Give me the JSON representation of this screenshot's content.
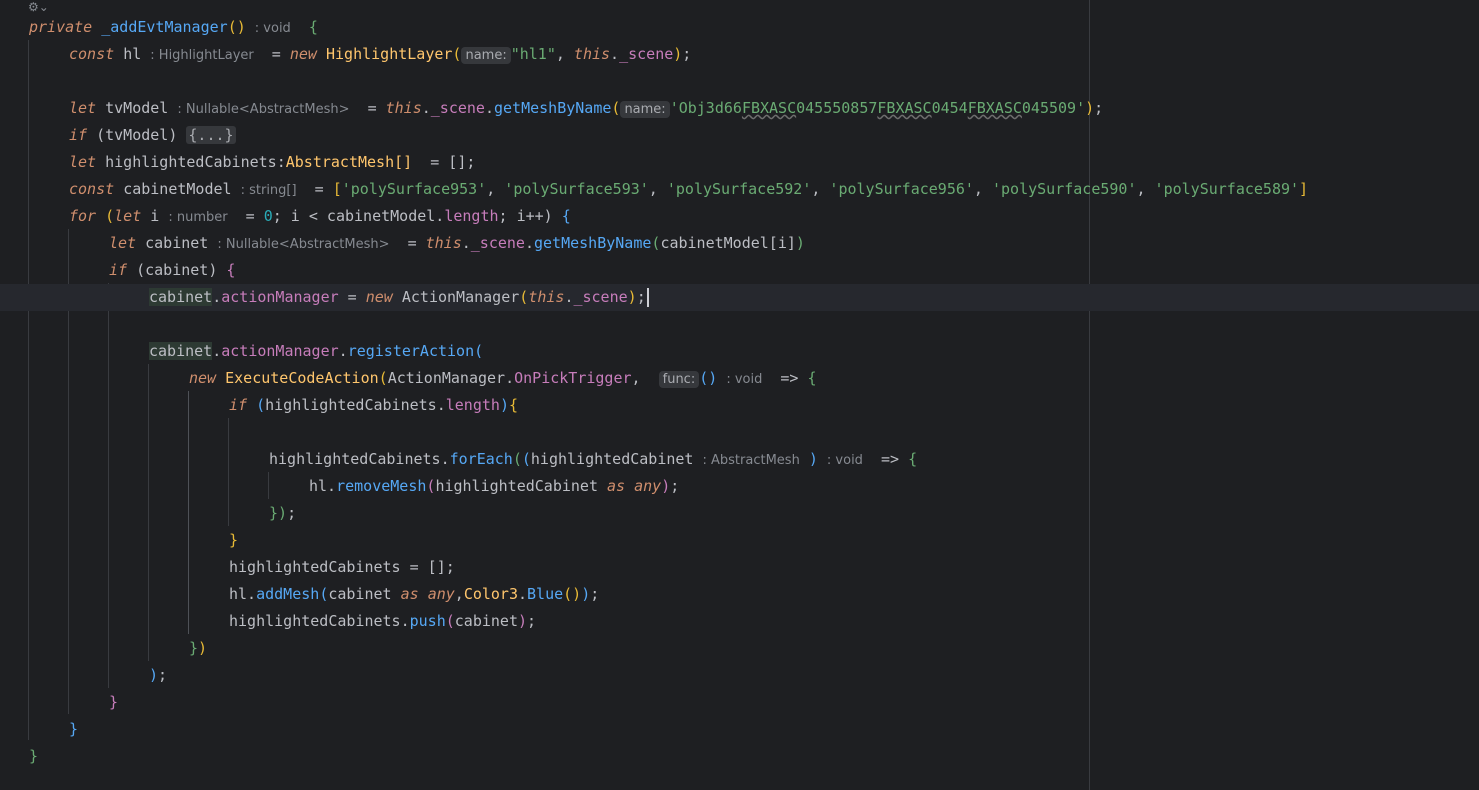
{
  "editor": {
    "gutter_icon_name": "settings-icon",
    "bulb_icon_name": "lightbulb-icon",
    "colors": {
      "background": "#1e1f22",
      "keyword": "#cf8e6d",
      "function": "#56a8f5",
      "class": "#ffc66d",
      "string": "#6aab73",
      "property": "#c77dbb"
    }
  },
  "code": {
    "l1_private": "private",
    "l1_method": "_addEvtManager",
    "l1_parens": "()",
    "l1_hint": ": void",
    "l1_brace": "{",
    "l2_const": "const",
    "l2_var": "hl",
    "l2_hint": ": HighlightLayer",
    "l2_eq": "=",
    "l2_new": "new",
    "l2_class": "HighlightLayer",
    "l2_chip": "name:",
    "l2_str": "\"hl1\"",
    "l2_this": "this",
    "l2_prop": "_scene",
    "l4_let": "let",
    "l4_var": "tvModel",
    "l4_hint": ": Nullable<AbstractMesh>",
    "l4_eq": "=",
    "l4_this": "this",
    "l4_scene": "_scene",
    "l4_fn": "getMeshByName",
    "l4_chip": "name:",
    "l4_str_a": "'Obj3d66",
    "l4_str_b": "FBXASC",
    "l4_str_c": "045550857",
    "l4_str_d": "FBXASC",
    "l4_str_e": "0454",
    "l4_str_f": "FBXASC",
    "l4_str_g": "045509'",
    "l5_if": "if",
    "l5_cond": "(tvModel)",
    "l5_fold": "{...}",
    "l6_let": "let",
    "l6_var": "highlightedCabinets:",
    "l6_type": "AbstractMesh[]",
    "l6_rest": "= [];",
    "l7_const": "const",
    "l7_var": "cabinetModel",
    "l7_hint": ": string[]",
    "l7_eq": "=",
    "l7_s1": "'polySurface953'",
    "l7_s2": "'polySurface593'",
    "l7_s3": "'polySurface592'",
    "l7_s4": "'polySurface956'",
    "l7_s5": "'polySurface590'",
    "l7_s6": "'polySurface589'",
    "l8_for": "for",
    "l8_let": "let",
    "l8_var": "i",
    "l8_hint": ": number",
    "l8_rest_a": "= ",
    "l8_zero": "0",
    "l8_rest_b": "; i < cabinetModel.",
    "l8_length": "length",
    "l8_rest_c": "; i++)",
    "l9_let": "let",
    "l9_var": "cabinet",
    "l9_hint": ": Nullable<AbstractMesh>",
    "l9_eq": "=",
    "l9_this": "this",
    "l9_scene": "_scene",
    "l9_fn": "getMeshByName",
    "l9_arg": "cabinetModel[i]",
    "l10_if": "if",
    "l10_cond": "(cabinet)",
    "l11_var": "cabinet",
    "l11_prop": "actionManager",
    "l11_eq": " = ",
    "l11_new": "new",
    "l11_class": "ActionManager",
    "l11_this": "this",
    "l11_scene": "_scene",
    "l13_var": "cabinet",
    "l13_prop": "actionManager",
    "l13_fn": "registerAction",
    "l14_new": "new",
    "l14_class": "ExecuteCodeAction",
    "l14_arg": "ActionManager.",
    "l14_const": "OnPickTrigger",
    "l14_chip": "func:",
    "l14_parens": "()",
    "l14_hint": ": void",
    "l14_arrow": "=>",
    "l15_if": "if",
    "l15_var": "highlightedCabinets.",
    "l15_length": "length",
    "l17_var": "highlightedCabinets.",
    "l17_fn": "forEach",
    "l17_param": "highlightedCabinet",
    "l17_hint1": ": AbstractMesh",
    "l17_hint2": ": void",
    "l17_arrow": "=>",
    "l18_var": "hl.",
    "l18_fn": "removeMesh",
    "l18_arg": "highlightedCabinet",
    "l18_as": "as",
    "l18_any": "any",
    "l21_text": "highlightedCabinets = [];",
    "l22_var": "hl.",
    "l22_fn": "addMesh",
    "l22_arg": "cabinet",
    "l22_as": "as",
    "l22_any": "any",
    "l22_class": "Color3",
    "l22_fn2": "Blue",
    "l23_var": "highlightedCabinets.",
    "l23_fn": "push",
    "l23_arg": "cabinet"
  }
}
